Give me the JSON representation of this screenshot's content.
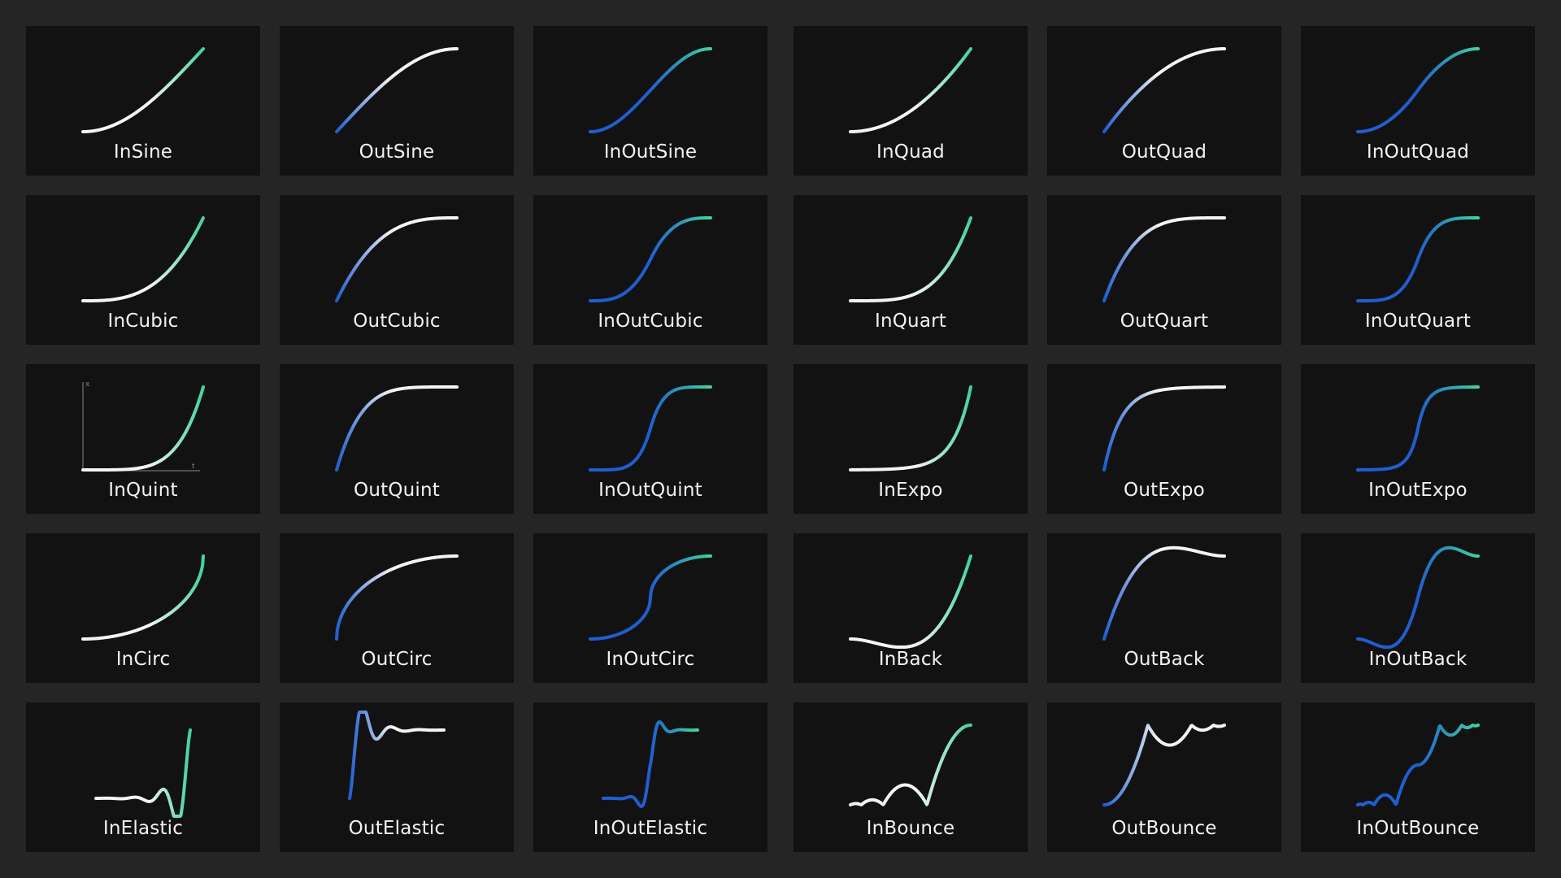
{
  "colors": {
    "background": "#252525",
    "card": "#121212",
    "text": "#f2f2f2",
    "curve_blue": "#1f5fd0",
    "curve_white": "#f4f4f4",
    "curve_green": "#3fd3a0",
    "axis": "#8a8a8a"
  },
  "axis_labels": {
    "y": "x",
    "x": "t"
  },
  "cards": [
    {
      "label": "InSine",
      "gradient": "white-green"
    },
    {
      "label": "OutSine",
      "gradient": "blue-white"
    },
    {
      "label": "InOutSine",
      "gradient": "blue-green"
    },
    {
      "label": "InQuad",
      "gradient": "white-green"
    },
    {
      "label": "OutQuad",
      "gradient": "blue-white"
    },
    {
      "label": "InOutQuad",
      "gradient": "blue-green"
    },
    {
      "label": "InCubic",
      "gradient": "white-green"
    },
    {
      "label": "OutCubic",
      "gradient": "blue-white"
    },
    {
      "label": "InOutCubic",
      "gradient": "blue-green"
    },
    {
      "label": "InQuart",
      "gradient": "white-green"
    },
    {
      "label": "OutQuart",
      "gradient": "blue-white"
    },
    {
      "label": "InOutQuart",
      "gradient": "blue-green"
    },
    {
      "label": "InQuint",
      "gradient": "white-green",
      "show_axes": true
    },
    {
      "label": "OutQuint",
      "gradient": "blue-white"
    },
    {
      "label": "InOutQuint",
      "gradient": "blue-green"
    },
    {
      "label": "InExpo",
      "gradient": "white-green"
    },
    {
      "label": "OutExpo",
      "gradient": "blue-white"
    },
    {
      "label": "InOutExpo",
      "gradient": "blue-green"
    },
    {
      "label": "InCirc",
      "gradient": "white-green"
    },
    {
      "label": "OutCirc",
      "gradient": "blue-white"
    },
    {
      "label": "InOutCirc",
      "gradient": "blue-green"
    },
    {
      "label": "InBack",
      "gradient": "white-green"
    },
    {
      "label": "OutBack",
      "gradient": "blue-white"
    },
    {
      "label": "InOutBack",
      "gradient": "blue-green"
    },
    {
      "label": "InElastic",
      "gradient": "white-green"
    },
    {
      "label": "OutElastic",
      "gradient": "blue-white"
    },
    {
      "label": "InOutElastic",
      "gradient": "blue-green"
    },
    {
      "label": "InBounce",
      "gradient": "white-green"
    },
    {
      "label": "OutBounce",
      "gradient": "blue-white"
    },
    {
      "label": "InOutBounce",
      "gradient": "blue-green"
    }
  ]
}
